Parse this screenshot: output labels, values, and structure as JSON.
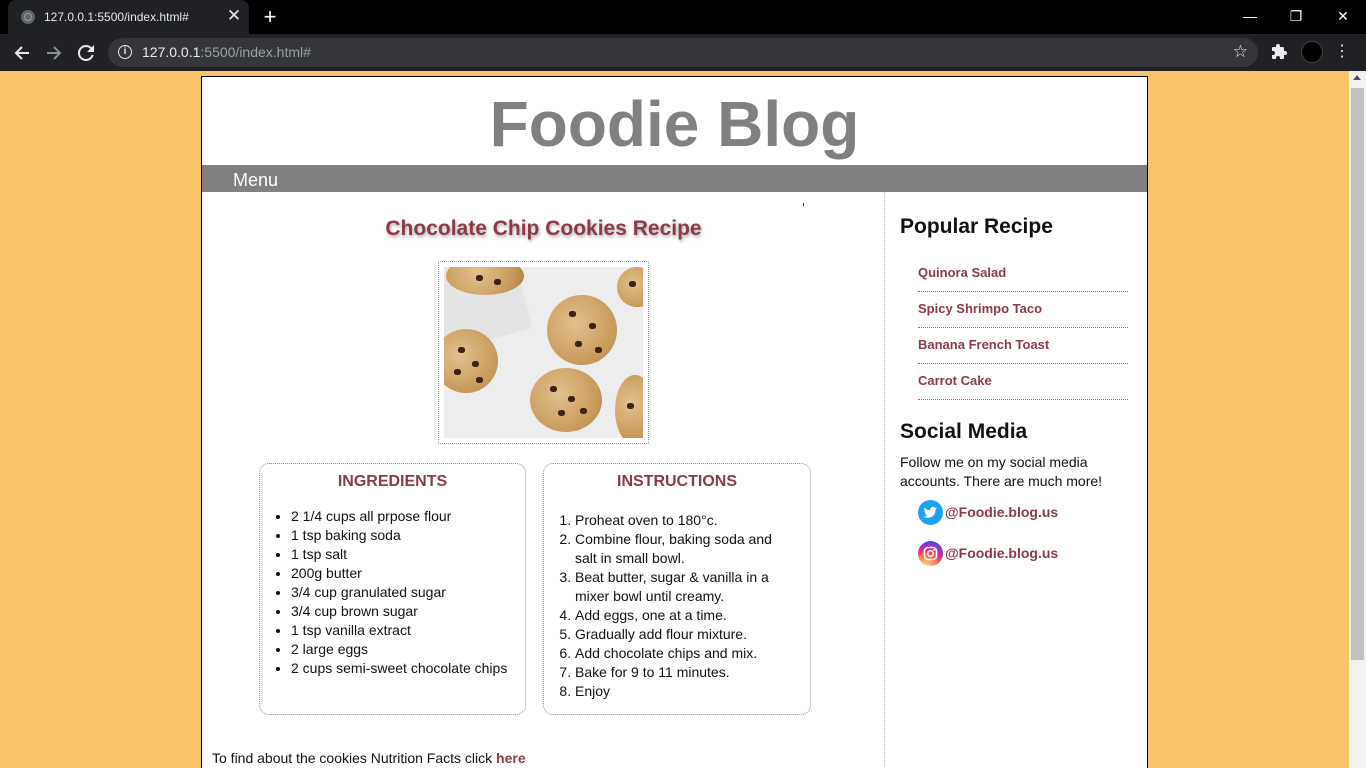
{
  "browser": {
    "tab_title": "127.0.0.1:5500/index.html#",
    "tab_close": "✕",
    "new_tab": "+",
    "url_host": "127.0.0.1",
    "url_rest": ":5500/index.html#",
    "window_controls": {
      "minimize": "—",
      "restore": "❐",
      "close": "✕"
    }
  },
  "blog": {
    "title": "Foodie Blog",
    "menu_label": "Menu"
  },
  "recipe": {
    "title": "Chocolate Chip Cookies Recipe",
    "ingredients_heading": "INGREDIENTS",
    "ingredients": [
      "2 1/4 cups all prpose flour",
      "1 tsp baking soda",
      "1 tsp salt",
      "200g butter",
      "3/4 cup granulated sugar",
      "3/4 cup brown sugar",
      "1 tsp vanilla extract",
      "2 large eggs",
      "2 cups semi-sweet chocolate chips"
    ],
    "instructions_heading": "INSTRUCTIONS",
    "instructions": [
      "Proheat oven to 180°c.",
      "Combine flour, baking soda and salt in small bowl.",
      "Beat butter, sugar & vanilla in a mixer bowl until creamy.",
      "Add eggs, one at a time.",
      "Gradually add flour mixture.",
      "Add chocolate chips and mix.",
      "Bake for 9 to 11 minutes.",
      "Enjoy"
    ],
    "nutrition_text": "To find about the cookies Nutrition Facts click ",
    "nutrition_link": "here"
  },
  "sidebar": {
    "popular_heading": "Popular Recipe",
    "popular_items": [
      "Quinora Salad",
      "Spicy Shrimpo Taco",
      "Banana French Toast",
      "Carrot Cake"
    ],
    "social_heading": "Social Media",
    "social_text": "Follow me on my social media accounts. There are much more!",
    "twitter_handle": "@Foodie.blog.us",
    "instagram_handle": "@Foodie.blog.us"
  },
  "colors": {
    "page_background": "#f7c469",
    "accent": "#8b3a46",
    "menu_bar": "#808080",
    "title_gray": "#808080"
  },
  "icons": [
    "favicon-icon",
    "close-icon",
    "new-tab-icon",
    "back-icon",
    "forward-icon",
    "reload-icon",
    "info-icon",
    "star-icon",
    "extensions-icon",
    "profile-icon",
    "menu-kebab-icon",
    "twitter-icon",
    "instagram-icon"
  ]
}
